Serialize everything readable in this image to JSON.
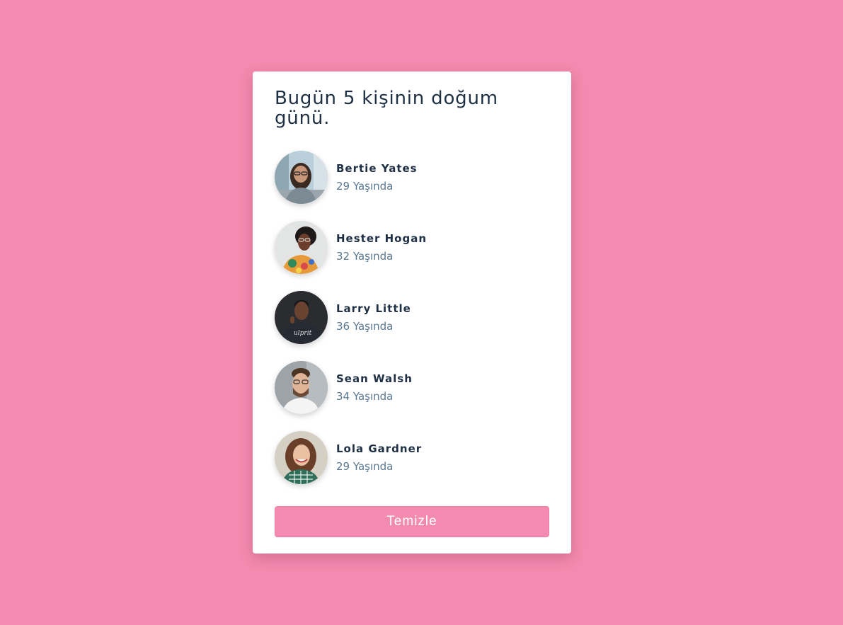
{
  "page": {
    "background": "#f48aaf",
    "card_background": "#ffffff"
  },
  "title": "Bugün 5 kişinin doğum günü.",
  "people": [
    {
      "name": "Bertie Yates",
      "age": "29 Yaşında",
      "avatar": "woman-glasses-street-photo"
    },
    {
      "name": "Hester Hogan",
      "age": "32 Yaşında",
      "avatar": "woman-glasses-colorful-shirt-photo"
    },
    {
      "name": "Larry Little",
      "age": "36 Yaşında",
      "avatar": "man-dark-tshirt-photo"
    },
    {
      "name": "Sean Walsh",
      "age": "34 Yaşında",
      "avatar": "man-glasses-beard-photo"
    },
    {
      "name": "Lola Gardner",
      "age": "29 Yaşında",
      "avatar": "woman-curly-hair-smiling-photo"
    }
  ],
  "clear_button": {
    "label": "Temizle",
    "color": "#f48aaf"
  }
}
